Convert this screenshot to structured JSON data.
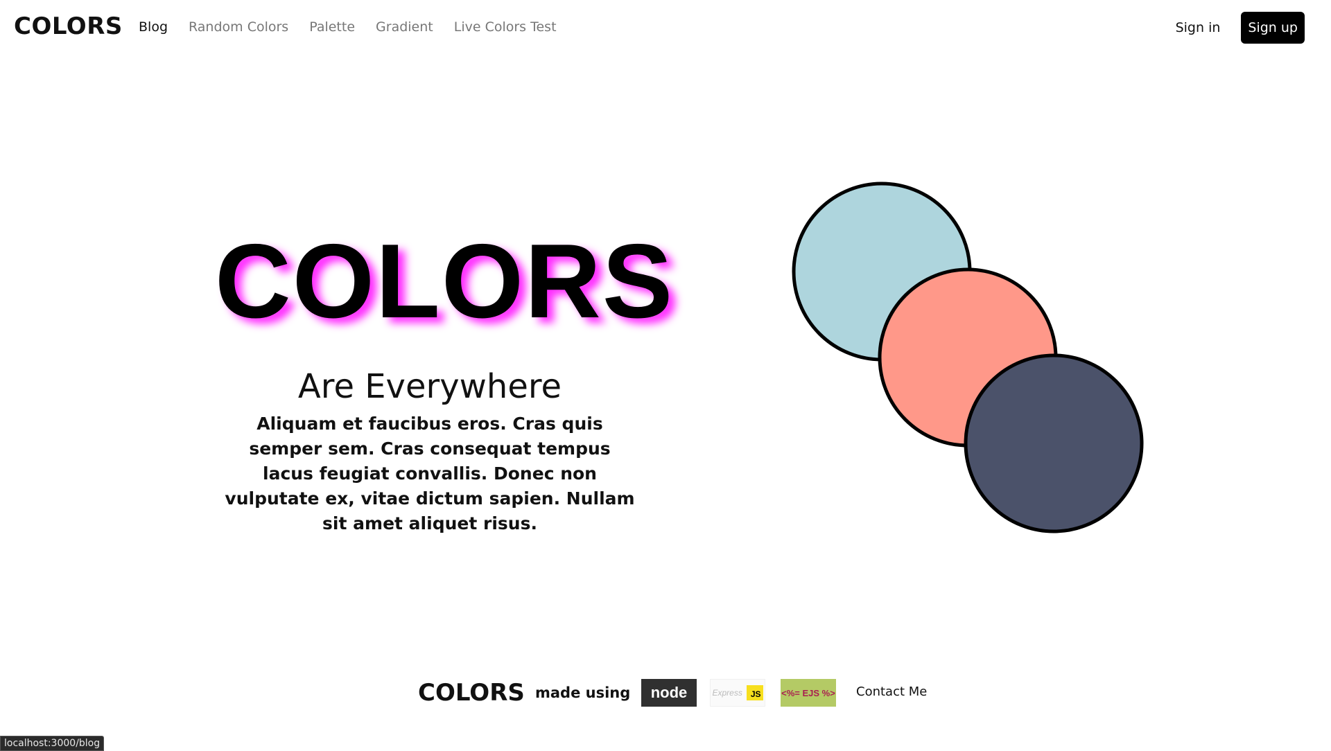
{
  "header": {
    "brand": "COLORS",
    "nav": [
      {
        "label": "Blog",
        "active": true
      },
      {
        "label": "Random Colors",
        "active": false
      },
      {
        "label": "Palette",
        "active": false
      },
      {
        "label": "Gradient",
        "active": false
      },
      {
        "label": "Live Colors Test",
        "active": false
      }
    ],
    "signin_label": "Sign in",
    "signup_label": "Sign up"
  },
  "hero": {
    "title": "COLORS",
    "subtitle": "Are Everywhere",
    "text": "Aliquam et faucibus eros. Cras quis semper sem. Cras consequat tempus lacus feugiat convallis. Donec non vulputate ex, vitae dictum sapien. Nullam sit amet aliquet risus.",
    "title_glow_color": "#ff2bff"
  },
  "circles": [
    {
      "color": "#aed5dd"
    },
    {
      "color": "#ff9889"
    },
    {
      "color": "#4b526a"
    }
  ],
  "footer": {
    "brand": "COLORS",
    "made_using": "made using",
    "logos": {
      "node": "node",
      "express": "Express",
      "express_js": "JS",
      "ejs": "<%= EJS %>"
    },
    "contact_label": "Contact Me"
  },
  "statusbar": {
    "url": "localhost:3000/blog"
  }
}
